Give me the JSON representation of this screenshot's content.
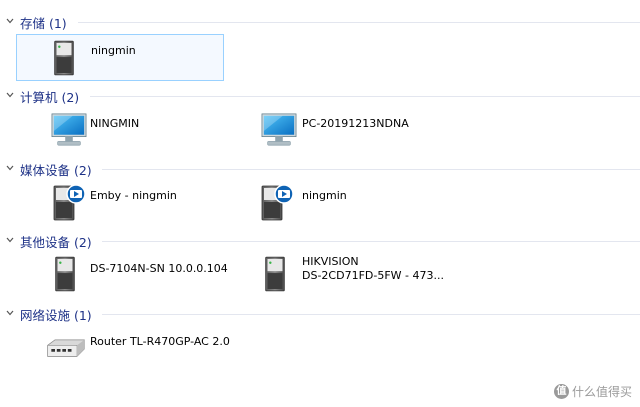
{
  "groups": [
    {
      "title": "存储 (1)",
      "items": [
        {
          "label": "ningmin",
          "icon": "storage-drive-icon",
          "selected": true
        }
      ]
    },
    {
      "title": "计算机 (2)",
      "items": [
        {
          "label": "NINGMIN",
          "icon": "computer-icon"
        },
        {
          "label": "PC-20191213NDNA",
          "icon": "computer-icon"
        }
      ]
    },
    {
      "title": "媒体设备 (2)",
      "items": [
        {
          "label": "Emby - ningmin",
          "icon": "media-server-icon"
        },
        {
          "label": "ningmin",
          "icon": "media-server-icon"
        }
      ]
    },
    {
      "title": "其他设备 (2)",
      "items": [
        {
          "label": "DS-7104N-SN 10.0.0.104",
          "icon": "device-icon"
        },
        {
          "label_line1": "HIKVISION",
          "label_line2": "DS-2CD71FD-5FW - 473...",
          "icon": "device-icon"
        }
      ]
    },
    {
      "title": "网络设施 (1)",
      "items": [
        {
          "label": "Router TL-R470GP-AC 2.0",
          "icon": "router-icon"
        }
      ]
    }
  ],
  "watermark": {
    "logo": "值",
    "text": "什么值得买"
  },
  "colors": {
    "group_title": "#1e3287",
    "selection_border": "#99d1ff",
    "selection_fill": "#f4f9ff"
  }
}
